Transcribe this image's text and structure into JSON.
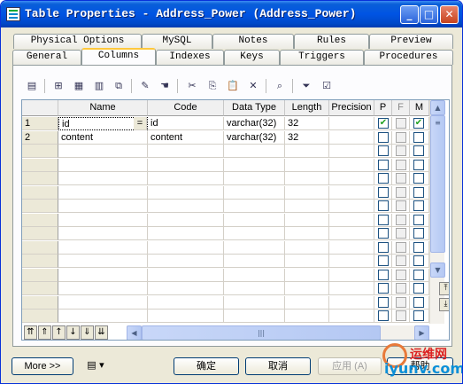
{
  "window": {
    "title": "Table Properties - Address_Power (Address_Power)"
  },
  "tabs_back": [
    {
      "label": "Physical Options"
    },
    {
      "label": "MySQL"
    },
    {
      "label": "Notes"
    },
    {
      "label": "Rules"
    },
    {
      "label": "Preview"
    }
  ],
  "tabs_front": [
    {
      "label": "General"
    },
    {
      "label": "Columns"
    },
    {
      "label": "Indexes"
    },
    {
      "label": "Keys"
    },
    {
      "label": "Triggers"
    },
    {
      "label": "Procedures"
    }
  ],
  "active_tab": "Columns",
  "grid": {
    "headers": [
      "Name",
      "Code",
      "Data Type",
      "Length",
      "Precision",
      "P",
      "F",
      "M"
    ],
    "rows": [
      {
        "num": "1",
        "name": "id",
        "code": "id",
        "type": "varchar(32)",
        "length": "32",
        "precision": "",
        "p": true,
        "f": false,
        "m": true
      },
      {
        "num": "2",
        "name": "content",
        "code": "content",
        "type": "varchar(32)",
        "length": "32",
        "precision": "",
        "p": false,
        "f": false,
        "m": false
      }
    ],
    "ellipsis": "="
  },
  "buttons": {
    "more": "More >>",
    "ok": "确定",
    "cancel": "取消",
    "apply": "应用 (A)",
    "help": "帮助"
  },
  "watermark": {
    "text": "运维网",
    "url": "iyunv.com"
  }
}
